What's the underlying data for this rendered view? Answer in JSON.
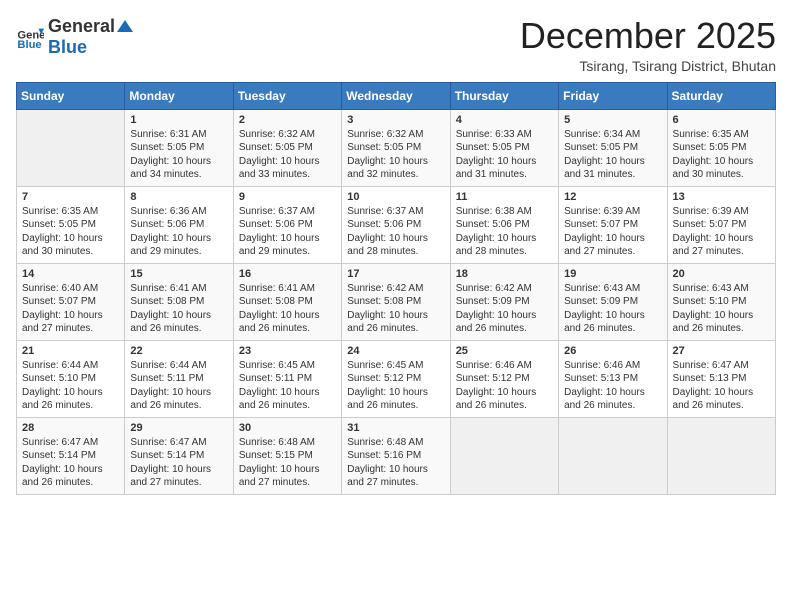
{
  "header": {
    "logo": {
      "general": "General",
      "blue": "Blue"
    },
    "title": "December 2025",
    "location": "Tsirang, Tsirang District, Bhutan"
  },
  "calendar": {
    "days_of_week": [
      "Sunday",
      "Monday",
      "Tuesday",
      "Wednesday",
      "Thursday",
      "Friday",
      "Saturday"
    ],
    "weeks": [
      [
        {
          "day": "",
          "sunrise": "",
          "sunset": "",
          "daylight": ""
        },
        {
          "day": "1",
          "sunrise": "Sunrise: 6:31 AM",
          "sunset": "Sunset: 5:05 PM",
          "daylight": "Daylight: 10 hours and 34 minutes."
        },
        {
          "day": "2",
          "sunrise": "Sunrise: 6:32 AM",
          "sunset": "Sunset: 5:05 PM",
          "daylight": "Daylight: 10 hours and 33 minutes."
        },
        {
          "day": "3",
          "sunrise": "Sunrise: 6:32 AM",
          "sunset": "Sunset: 5:05 PM",
          "daylight": "Daylight: 10 hours and 32 minutes."
        },
        {
          "day": "4",
          "sunrise": "Sunrise: 6:33 AM",
          "sunset": "Sunset: 5:05 PM",
          "daylight": "Daylight: 10 hours and 31 minutes."
        },
        {
          "day": "5",
          "sunrise": "Sunrise: 6:34 AM",
          "sunset": "Sunset: 5:05 PM",
          "daylight": "Daylight: 10 hours and 31 minutes."
        },
        {
          "day": "6",
          "sunrise": "Sunrise: 6:35 AM",
          "sunset": "Sunset: 5:05 PM",
          "daylight": "Daylight: 10 hours and 30 minutes."
        }
      ],
      [
        {
          "day": "7",
          "sunrise": "Sunrise: 6:35 AM",
          "sunset": "Sunset: 5:05 PM",
          "daylight": "Daylight: 10 hours and 30 minutes."
        },
        {
          "day": "8",
          "sunrise": "Sunrise: 6:36 AM",
          "sunset": "Sunset: 5:06 PM",
          "daylight": "Daylight: 10 hours and 29 minutes."
        },
        {
          "day": "9",
          "sunrise": "Sunrise: 6:37 AM",
          "sunset": "Sunset: 5:06 PM",
          "daylight": "Daylight: 10 hours and 29 minutes."
        },
        {
          "day": "10",
          "sunrise": "Sunrise: 6:37 AM",
          "sunset": "Sunset: 5:06 PM",
          "daylight": "Daylight: 10 hours and 28 minutes."
        },
        {
          "day": "11",
          "sunrise": "Sunrise: 6:38 AM",
          "sunset": "Sunset: 5:06 PM",
          "daylight": "Daylight: 10 hours and 28 minutes."
        },
        {
          "day": "12",
          "sunrise": "Sunrise: 6:39 AM",
          "sunset": "Sunset: 5:07 PM",
          "daylight": "Daylight: 10 hours and 27 minutes."
        },
        {
          "day": "13",
          "sunrise": "Sunrise: 6:39 AM",
          "sunset": "Sunset: 5:07 PM",
          "daylight": "Daylight: 10 hours and 27 minutes."
        }
      ],
      [
        {
          "day": "14",
          "sunrise": "Sunrise: 6:40 AM",
          "sunset": "Sunset: 5:07 PM",
          "daylight": "Daylight: 10 hours and 27 minutes."
        },
        {
          "day": "15",
          "sunrise": "Sunrise: 6:41 AM",
          "sunset": "Sunset: 5:08 PM",
          "daylight": "Daylight: 10 hours and 26 minutes."
        },
        {
          "day": "16",
          "sunrise": "Sunrise: 6:41 AM",
          "sunset": "Sunset: 5:08 PM",
          "daylight": "Daylight: 10 hours and 26 minutes."
        },
        {
          "day": "17",
          "sunrise": "Sunrise: 6:42 AM",
          "sunset": "Sunset: 5:08 PM",
          "daylight": "Daylight: 10 hours and 26 minutes."
        },
        {
          "day": "18",
          "sunrise": "Sunrise: 6:42 AM",
          "sunset": "Sunset: 5:09 PM",
          "daylight": "Daylight: 10 hours and 26 minutes."
        },
        {
          "day": "19",
          "sunrise": "Sunrise: 6:43 AM",
          "sunset": "Sunset: 5:09 PM",
          "daylight": "Daylight: 10 hours and 26 minutes."
        },
        {
          "day": "20",
          "sunrise": "Sunrise: 6:43 AM",
          "sunset": "Sunset: 5:10 PM",
          "daylight": "Daylight: 10 hours and 26 minutes."
        }
      ],
      [
        {
          "day": "21",
          "sunrise": "Sunrise: 6:44 AM",
          "sunset": "Sunset: 5:10 PM",
          "daylight": "Daylight: 10 hours and 26 minutes."
        },
        {
          "day": "22",
          "sunrise": "Sunrise: 6:44 AM",
          "sunset": "Sunset: 5:11 PM",
          "daylight": "Daylight: 10 hours and 26 minutes."
        },
        {
          "day": "23",
          "sunrise": "Sunrise: 6:45 AM",
          "sunset": "Sunset: 5:11 PM",
          "daylight": "Daylight: 10 hours and 26 minutes."
        },
        {
          "day": "24",
          "sunrise": "Sunrise: 6:45 AM",
          "sunset": "Sunset: 5:12 PM",
          "daylight": "Daylight: 10 hours and 26 minutes."
        },
        {
          "day": "25",
          "sunrise": "Sunrise: 6:46 AM",
          "sunset": "Sunset: 5:12 PM",
          "daylight": "Daylight: 10 hours and 26 minutes."
        },
        {
          "day": "26",
          "sunrise": "Sunrise: 6:46 AM",
          "sunset": "Sunset: 5:13 PM",
          "daylight": "Daylight: 10 hours and 26 minutes."
        },
        {
          "day": "27",
          "sunrise": "Sunrise: 6:47 AM",
          "sunset": "Sunset: 5:13 PM",
          "daylight": "Daylight: 10 hours and 26 minutes."
        }
      ],
      [
        {
          "day": "28",
          "sunrise": "Sunrise: 6:47 AM",
          "sunset": "Sunset: 5:14 PM",
          "daylight": "Daylight: 10 hours and 26 minutes."
        },
        {
          "day": "29",
          "sunrise": "Sunrise: 6:47 AM",
          "sunset": "Sunset: 5:14 PM",
          "daylight": "Daylight: 10 hours and 27 minutes."
        },
        {
          "day": "30",
          "sunrise": "Sunrise: 6:48 AM",
          "sunset": "Sunset: 5:15 PM",
          "daylight": "Daylight: 10 hours and 27 minutes."
        },
        {
          "day": "31",
          "sunrise": "Sunrise: 6:48 AM",
          "sunset": "Sunset: 5:16 PM",
          "daylight": "Daylight: 10 hours and 27 minutes."
        },
        {
          "day": "",
          "sunrise": "",
          "sunset": "",
          "daylight": ""
        },
        {
          "day": "",
          "sunrise": "",
          "sunset": "",
          "daylight": ""
        },
        {
          "day": "",
          "sunrise": "",
          "sunset": "",
          "daylight": ""
        }
      ]
    ]
  }
}
